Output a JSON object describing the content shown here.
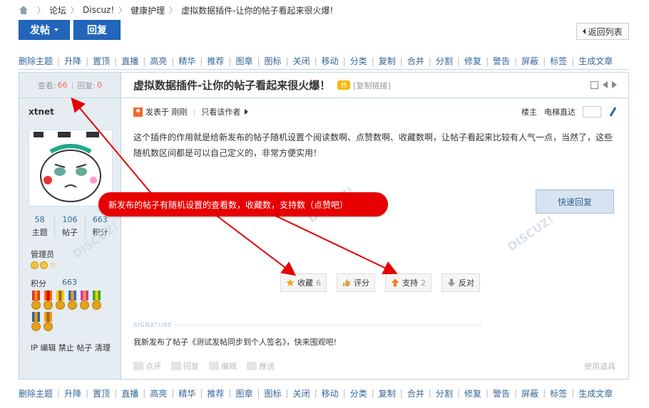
{
  "breadcrumb": {
    "items": [
      "论坛",
      "Discuz!",
      "健康护理",
      "虚拟数据插件-让你的帖子看起来很火爆!"
    ]
  },
  "buttons": {
    "post": "发帖",
    "reply": "回复",
    "back": "返回列表"
  },
  "mod_bar": {
    "items": [
      "删除主题",
      "升降",
      "置顶",
      "直播",
      "高亮",
      "精华",
      "推荐",
      "图章",
      "图标",
      "关闭",
      "移动",
      "分类",
      "复制",
      "合并",
      "分割",
      "修复",
      "警告",
      "屏蔽",
      "标签",
      "生成文章"
    ]
  },
  "thread": {
    "views_label": "查看:",
    "views": "66",
    "replies_label": "回复:",
    "replies": "0",
    "title": "虚拟数据插件-让你的帖子看起来很火爆！",
    "copy_link": "[复制链接]"
  },
  "author": {
    "name": "xtnet",
    "stats": [
      {
        "value": "58",
        "label": "主题"
      },
      {
        "value": "106",
        "label": "帖子"
      },
      {
        "value": "663",
        "label": "积分"
      }
    ],
    "group": "管理员",
    "credits_label": "积分",
    "credits": "663",
    "ops": [
      "IP",
      "编辑",
      "禁止",
      "帖子",
      "清理"
    ]
  },
  "post": {
    "posted": "发表于 刚刚",
    "only_author": "只看该作者",
    "floor": "楼主",
    "jump": "电梯直达",
    "content": "这个插件的作用就是给新发布的帖子随机设置个阅读数啊、点赞数啊、收藏数啊，让帖子看起来比较有人气一点，当然了，这些随机数区间都是可以自己定义的，非常方便实用！",
    "quick_reply": "快速回复",
    "actions": [
      {
        "label": "收藏",
        "count": "6"
      },
      {
        "label": "评分",
        "count": ""
      },
      {
        "label": "支持",
        "count": "2"
      },
      {
        "label": "反对",
        "count": ""
      }
    ],
    "signature_label": "SIGNATURE",
    "signature": "我新发布了帖子《测试发帖同步到个人签名》，快来围观吧!",
    "bottom_actions": [
      "点评",
      "回复",
      "编辑",
      "推送"
    ],
    "tools": "使用道具"
  },
  "callout": "新发布的帖子有随机设置的查看数，收藏数，支持数（点赞吧）",
  "colors": {
    "accent": "#2266bb",
    "callout": "#e60000",
    "count": "#f26c4f"
  }
}
